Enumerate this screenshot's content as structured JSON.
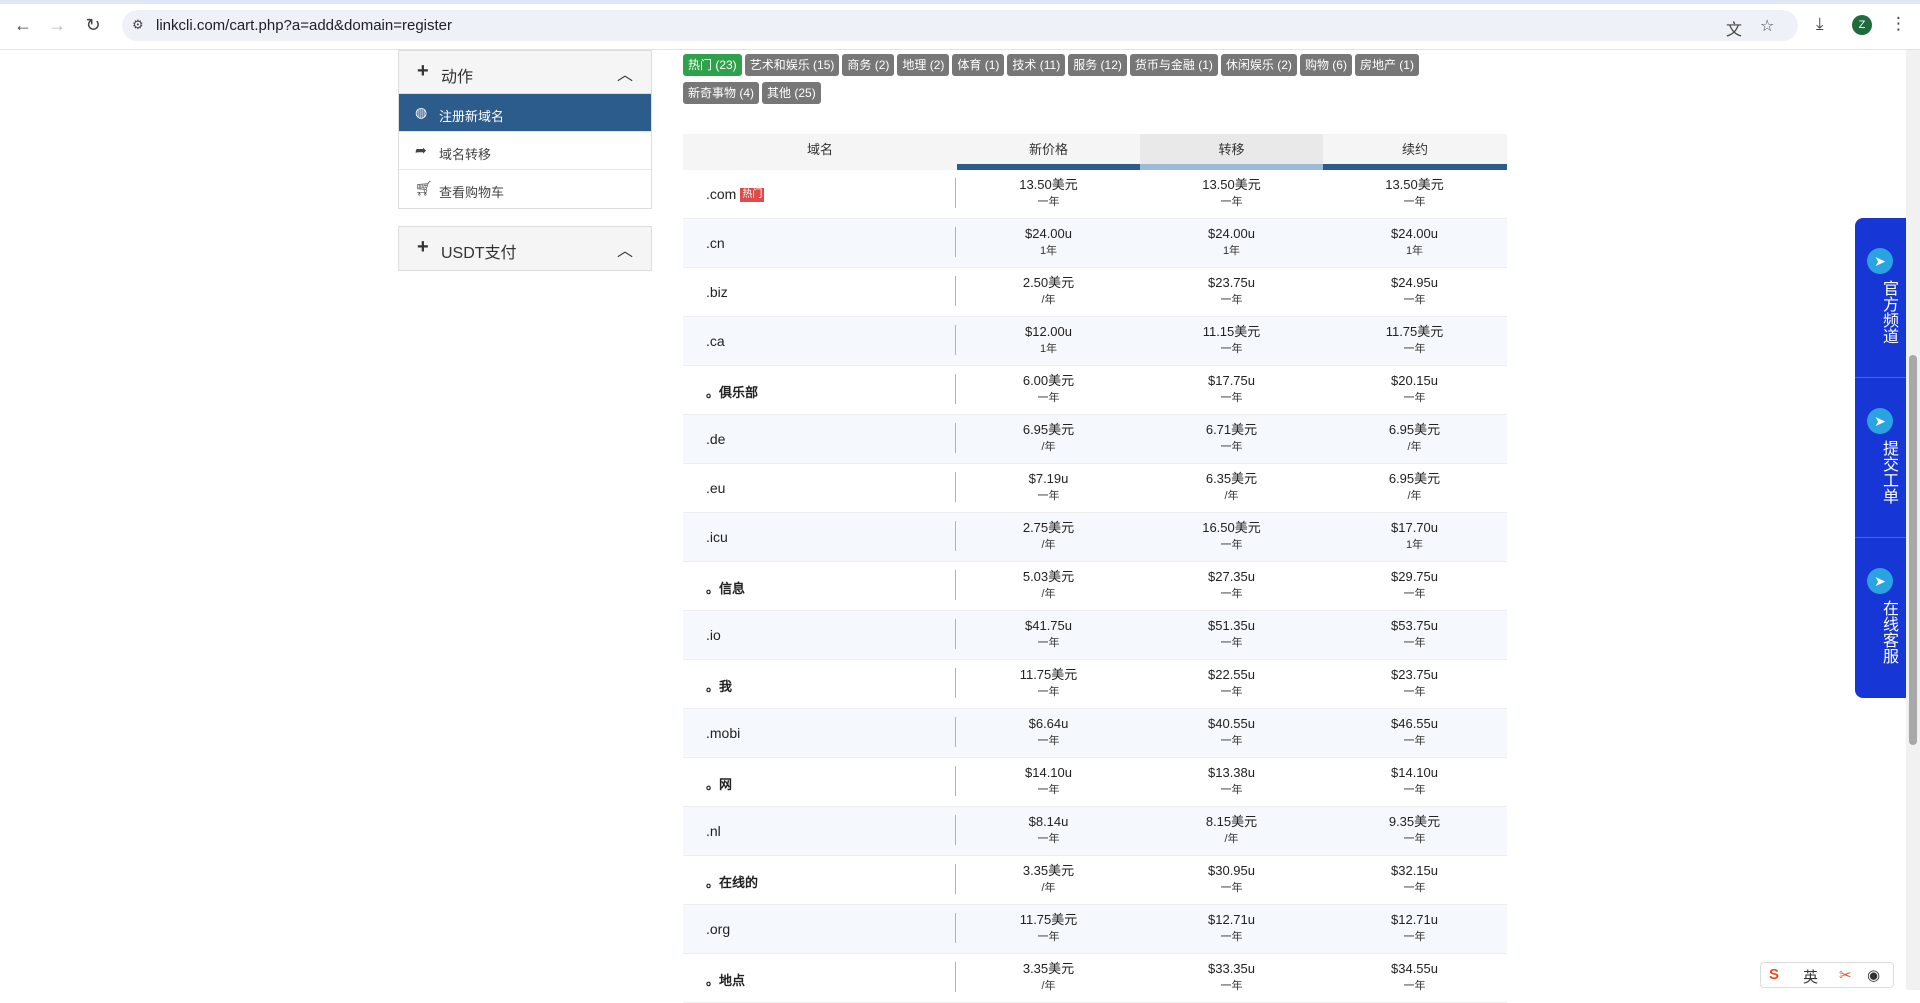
{
  "browser": {
    "url": "linkcli.com/cart.php?a=add&domain=register",
    "avatar_letter": "Z"
  },
  "sidebar": {
    "actions_title": "动作",
    "items": [
      {
        "label": "注册新域名",
        "icon": "globe-icon",
        "active": true
      },
      {
        "label": "域名转移",
        "icon": "share-icon",
        "active": false
      },
      {
        "label": "查看购物车",
        "icon": "cart-icon",
        "active": false
      }
    ],
    "usdt_title": "USDT支付"
  },
  "categories": [
    {
      "label": "热门 (23)",
      "active": true
    },
    {
      "label": "艺术和娱乐 (15)"
    },
    {
      "label": "商务 (2)"
    },
    {
      "label": "地理 (2)"
    },
    {
      "label": "体育 (1)"
    },
    {
      "label": "技术 (11)"
    },
    {
      "label": "服务 (12)"
    },
    {
      "label": "货币与金融 (1)"
    },
    {
      "label": "休闲娱乐 (2)"
    },
    {
      "label": "购物 (6)"
    },
    {
      "label": "房地产 (1)"
    },
    {
      "label": "新奇事物 (4)"
    },
    {
      "label": "其他 (25)"
    }
  ],
  "table": {
    "headers": {
      "domain": "域名",
      "new_price": "新价格",
      "transfer": "转移",
      "renew": "续约"
    },
    "hot_badge": "热门",
    "rows": [
      {
        "tld": ".com",
        "hot": true,
        "new": [
          "13.50美元",
          "一年"
        ],
        "transfer": [
          "13.50美元",
          "一年"
        ],
        "renew": [
          "13.50美元",
          "一年"
        ]
      },
      {
        "tld": ".cn",
        "new": [
          "$24.00u",
          "1年"
        ],
        "transfer": [
          "$24.00u",
          "1年"
        ],
        "renew": [
          "$24.00u",
          "1年"
        ]
      },
      {
        "tld": ".biz",
        "new": [
          "2.50美元",
          "/年"
        ],
        "transfer": [
          "$23.75u",
          "一年"
        ],
        "renew": [
          "$24.95u",
          "一年"
        ]
      },
      {
        "tld": ".ca",
        "new": [
          "$12.00u",
          "1年"
        ],
        "transfer": [
          "11.15美元",
          "一年"
        ],
        "renew": [
          "11.75美元",
          "一年"
        ]
      },
      {
        "tld": "。俱乐部",
        "cjk": true,
        "new": [
          "6.00美元",
          "一年"
        ],
        "transfer": [
          "$17.75u",
          "一年"
        ],
        "renew": [
          "$20.15u",
          "一年"
        ]
      },
      {
        "tld": ".de",
        "new": [
          "6.95美元",
          "/年"
        ],
        "transfer": [
          "6.71美元",
          "一年"
        ],
        "renew": [
          "6.95美元",
          "/年"
        ]
      },
      {
        "tld": ".eu",
        "new": [
          "$7.19u",
          "一年"
        ],
        "transfer": [
          "6.35美元",
          "/年"
        ],
        "renew": [
          "6.95美元",
          "/年"
        ]
      },
      {
        "tld": ".icu",
        "new": [
          "2.75美元",
          "/年"
        ],
        "transfer": [
          "16.50美元",
          "一年"
        ],
        "renew": [
          "$17.70u",
          "1年"
        ]
      },
      {
        "tld": "。信息",
        "cjk": true,
        "new": [
          "5.03美元",
          "/年"
        ],
        "transfer": [
          "$27.35u",
          "一年"
        ],
        "renew": [
          "$29.75u",
          "一年"
        ]
      },
      {
        "tld": ".io",
        "new": [
          "$41.75u",
          "一年"
        ],
        "transfer": [
          "$51.35u",
          "一年"
        ],
        "renew": [
          "$53.75u",
          "一年"
        ]
      },
      {
        "tld": "。我",
        "cjk": true,
        "new": [
          "11.75美元",
          "一年"
        ],
        "transfer": [
          "$22.55u",
          "一年"
        ],
        "renew": [
          "$23.75u",
          "一年"
        ]
      },
      {
        "tld": ".mobi",
        "new": [
          "$6.64u",
          "一年"
        ],
        "transfer": [
          "$40.55u",
          "一年"
        ],
        "renew": [
          "$46.55u",
          "一年"
        ]
      },
      {
        "tld": "。网",
        "cjk": true,
        "new": [
          "$14.10u",
          "一年"
        ],
        "transfer": [
          "$13.38u",
          "一年"
        ],
        "renew": [
          "$14.10u",
          "一年"
        ]
      },
      {
        "tld": ".nl",
        "new": [
          "$8.14u",
          "一年"
        ],
        "transfer": [
          "8.15美元",
          "/年"
        ],
        "renew": [
          "9.35美元",
          "一年"
        ]
      },
      {
        "tld": "。在线的",
        "cjk": true,
        "new": [
          "3.35美元",
          "/年"
        ],
        "transfer": [
          "$30.95u",
          "一年"
        ],
        "renew": [
          "$32.15u",
          "一年"
        ]
      },
      {
        "tld": ".org",
        "new": [
          "11.75美元",
          "一年"
        ],
        "transfer": [
          "$12.71u",
          "一年"
        ],
        "renew": [
          "$12.71u",
          "一年"
        ]
      },
      {
        "tld": "。地点",
        "cjk": true,
        "new": [
          "3.35美元",
          "/年"
        ],
        "transfer": [
          "$33.35u",
          "一年"
        ],
        "renew": [
          "$34.55u",
          "一年"
        ]
      }
    ]
  },
  "float_widget": [
    {
      "label": "官方频道",
      "icon": "telegram-icon"
    },
    {
      "label": "提交工单",
      "icon": "telegram-icon"
    },
    {
      "label": "在线客服",
      "icon": "telegram-icon"
    }
  ],
  "ime": {
    "mode_label": "英"
  },
  "colors": {
    "primary": "#2c5c8c",
    "tag_active": "#2ea24a",
    "tag": "#777777",
    "float_bg": "#1637d6",
    "hot": "#e04a4a"
  }
}
